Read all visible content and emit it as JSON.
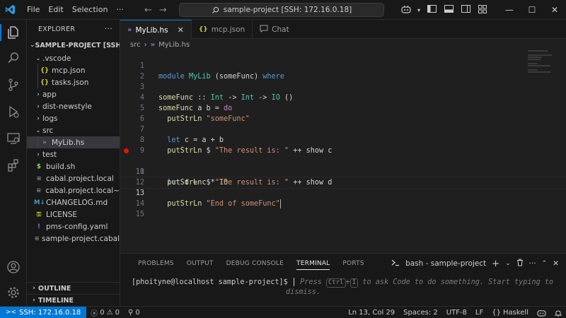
{
  "titlebar": {
    "menu": [
      "File",
      "Edit",
      "Selection",
      "···"
    ],
    "search_text": "sample-project [SSH: 172.16.0.18]"
  },
  "explorer": {
    "header": "EXPLORER",
    "root": "SAMPLE-PROJECT [SSH: 1...",
    "items": [
      {
        "label": ".vscode",
        "type": "folder-open",
        "depth": 1
      },
      {
        "label": "mcp.json",
        "type": "json",
        "depth": 2
      },
      {
        "label": "tasks.json",
        "type": "json",
        "depth": 2
      },
      {
        "label": "app",
        "type": "folder",
        "depth": 1
      },
      {
        "label": "dist-newstyle",
        "type": "folder",
        "depth": 1
      },
      {
        "label": "logs",
        "type": "folder",
        "depth": 1
      },
      {
        "label": "src",
        "type": "folder-open",
        "depth": 1
      },
      {
        "label": "MyLib.hs",
        "type": "haskell",
        "depth": 2,
        "selected": true
      },
      {
        "label": "test",
        "type": "folder",
        "depth": 1
      },
      {
        "label": "build.sh",
        "type": "shell",
        "depth": 1
      },
      {
        "label": "cabal.project.local",
        "type": "text",
        "depth": 1
      },
      {
        "label": "cabal.project.local~",
        "type": "text",
        "depth": 1
      },
      {
        "label": "CHANGELOG.md",
        "type": "markdown",
        "depth": 1
      },
      {
        "label": "LICENSE",
        "type": "license",
        "depth": 1
      },
      {
        "label": "pms-config.yaml",
        "type": "yaml",
        "depth": 1
      },
      {
        "label": "sample-project.cabal",
        "type": "cabal",
        "depth": 1
      }
    ],
    "outline": "OUTLINE",
    "timeline": "TIMELINE"
  },
  "tabs": [
    {
      "label": "MyLib.hs",
      "icon": "haskell",
      "active": true
    },
    {
      "label": "mcp.json",
      "icon": "json",
      "active": false
    },
    {
      "label": "Chat",
      "icon": "chat",
      "active": false
    }
  ],
  "breadcrumb": {
    "folder": "src",
    "file": "MyLib.hs"
  },
  "editor": {
    "current_line": 13,
    "breakpoint_line": 10,
    "lines": [
      {
        "n": "1"
      },
      {
        "n": "2"
      },
      {
        "n": "3"
      },
      {
        "n": "4"
      },
      {
        "n": "5"
      },
      {
        "n": "6"
      },
      {
        "n": "7"
      },
      {
        "n": "8"
      },
      {
        "n": "9"
      },
      {
        "n": "10"
      },
      {
        "n": "11"
      },
      {
        "n": "12"
      },
      {
        "n": "13"
      },
      {
        "n": "14"
      },
      {
        "n": "15"
      }
    ],
    "code": {
      "l1_kw": "module",
      "l1_mod": "MyLib",
      "l1_rest": "(someFunc)",
      "l1_where": "where",
      "l3_fn": "someFunc",
      "l3_sig": "::",
      "l3_t1": "Int",
      "l3_arr1": "->",
      "l3_t2": "Int",
      "l3_arr2": "->",
      "l3_t3": "IO",
      "l3_unit": "()",
      "l4_fn": "someFunc",
      "l4_args": "a b =",
      "l4_do": "do",
      "l5_fn": "putStrLn",
      "l5_str": "\"someFunc\"",
      "l7_let": "let",
      "l7_rest": "c = a + b",
      "l8_fn": "putStrLn",
      "l8_op": "$",
      "l8_str": "\"The result is: \"",
      "l8_rest": "++ show c",
      "l10_let": "let",
      "l10_rest": "d = c *",
      "l10_num": "10",
      "l11_fn": "putStrLn",
      "l11_op": "$",
      "l11_str": "\"The result is: \"",
      "l11_rest": "++ show d",
      "l13_fn": "putStrLn",
      "l13_str": "\"End of someFunc\""
    }
  },
  "panel": {
    "tabs": [
      "PROBLEMS",
      "OUTPUT",
      "DEBUG CONSOLE",
      "TERMINAL",
      "PORTS"
    ],
    "active_tab": "TERMINAL",
    "terminal_name": "bash - sample-project",
    "prompt": "[phoityne@localhost sample-project]$",
    "hint_part1": "Press",
    "hint_key1": "Ctrl",
    "hint_plus": "+",
    "hint_key2": "I",
    "hint_part2": "to ask Code to do something. Start typing to",
    "hint_part3": "dismiss."
  },
  "statusbar": {
    "remote": "SSH: 172.16.0.18",
    "errors": "0",
    "warnings": "0",
    "ports": "0",
    "position": "Ln 13, Col 29",
    "spaces": "Spaces: 2",
    "encoding": "UTF-8",
    "eol": "LF",
    "language": "Haskell"
  },
  "colors": {
    "accent": "#0078d4",
    "breakpoint": "#e51400",
    "haskell_icon": "#a074c4"
  }
}
